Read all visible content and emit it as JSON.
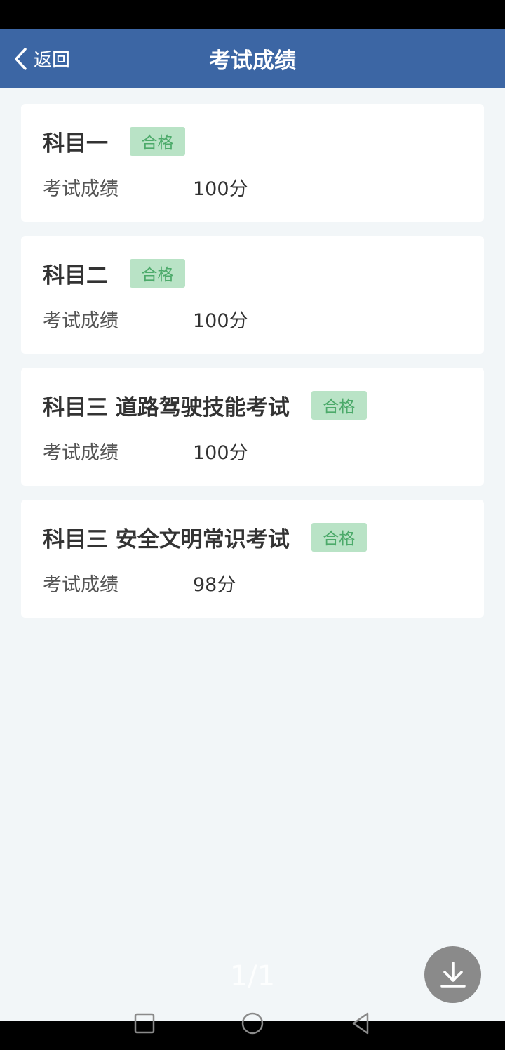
{
  "header": {
    "back_label": "返回",
    "title": "考试成绩",
    "background": "#3c66a4"
  },
  "results": [
    {
      "subject": "科目一",
      "status": "合格",
      "score_label": "考试成绩",
      "score": "100分"
    },
    {
      "subject": "科目二",
      "status": "合格",
      "score_label": "考试成绩",
      "score": "100分"
    },
    {
      "subject": "科目三 道路驾驶技能考试",
      "status": "合格",
      "score_label": "考试成绩",
      "score": "100分"
    },
    {
      "subject": "科目三 安全文明常识考试",
      "status": "合格",
      "score_label": "考试成绩",
      "score": "98分"
    }
  ],
  "pager": {
    "text": "1/1"
  },
  "icons": {
    "back": "chevron-left-icon",
    "download": "download-icon",
    "nav_recent": "square-icon",
    "nav_home": "circle-icon",
    "nav_back": "triangle-back-icon"
  },
  "colors": {
    "badge_bg": "#b9e3c6",
    "badge_text": "#4caa6a",
    "page_bg": "#f2f6f8"
  }
}
